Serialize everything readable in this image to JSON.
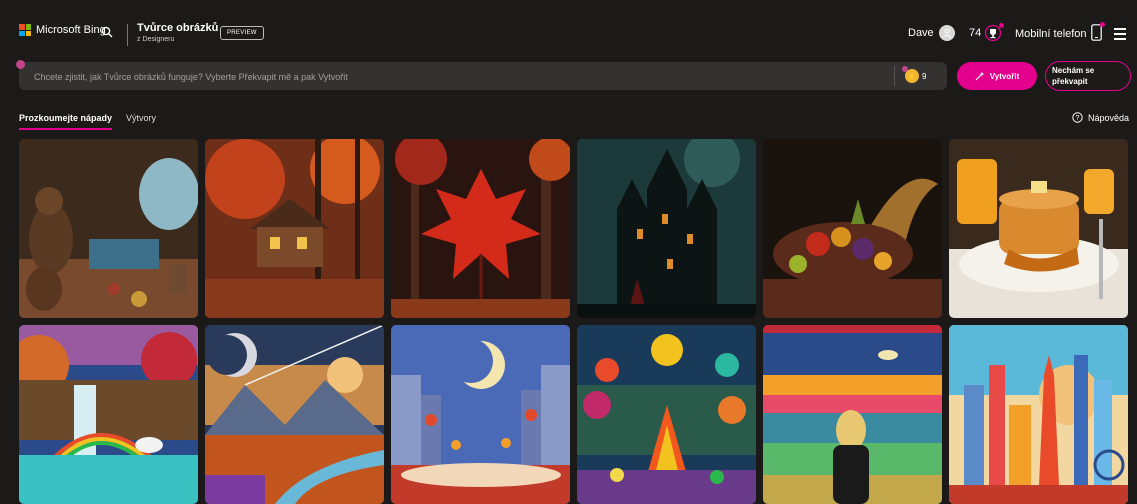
{
  "header": {
    "brand": "Microsoft Bing",
    "title": "Tvůrce obrázků",
    "subtitle": "z Designeru",
    "badge": "PREVIEW",
    "user_name": "Dave",
    "coins": "74",
    "mobile_label": "Mobilní telefon"
  },
  "prompt": {
    "placeholder": "Chcete zjistit, jak Tvůrce obrázků funguje? Vyberte Překvapit mě a pak Vytvořit",
    "boosts": "9",
    "create_label": "Vytvořit",
    "surprise_label": "Nechám se překvapit"
  },
  "tabs": [
    {
      "label": "Prozkoumejte nápady",
      "active": true
    },
    {
      "label": "Výtvory",
      "active": false
    }
  ],
  "help_label": "Nápověda",
  "colors": {
    "accent": "#e3008c",
    "background": "#1b1a19",
    "prompt_bg": "#333231"
  },
  "gallery": [
    {
      "subject": "bears-in-cave",
      "icon": "image-icon"
    },
    {
      "subject": "autumn-cabin",
      "icon": "image-icon"
    },
    {
      "subject": "red-maple-leaf",
      "icon": "image-icon"
    },
    {
      "subject": "dark-castle",
      "icon": "image-icon"
    },
    {
      "subject": "cornucopia",
      "icon": "image-icon"
    },
    {
      "subject": "pancakes-and-juice",
      "icon": "image-icon"
    },
    {
      "subject": "waterfall-rainbow-unicorn",
      "icon": "image-icon"
    },
    {
      "subject": "planets-over-valley",
      "icon": "image-icon"
    },
    {
      "subject": "moonlit-lantern-city",
      "icon": "image-icon"
    },
    {
      "subject": "bonfire-folk-art",
      "icon": "image-icon"
    },
    {
      "subject": "woman-at-embroidered-sea",
      "icon": "image-icon"
    },
    {
      "subject": "papercraft-skyline",
      "icon": "image-icon"
    }
  ]
}
